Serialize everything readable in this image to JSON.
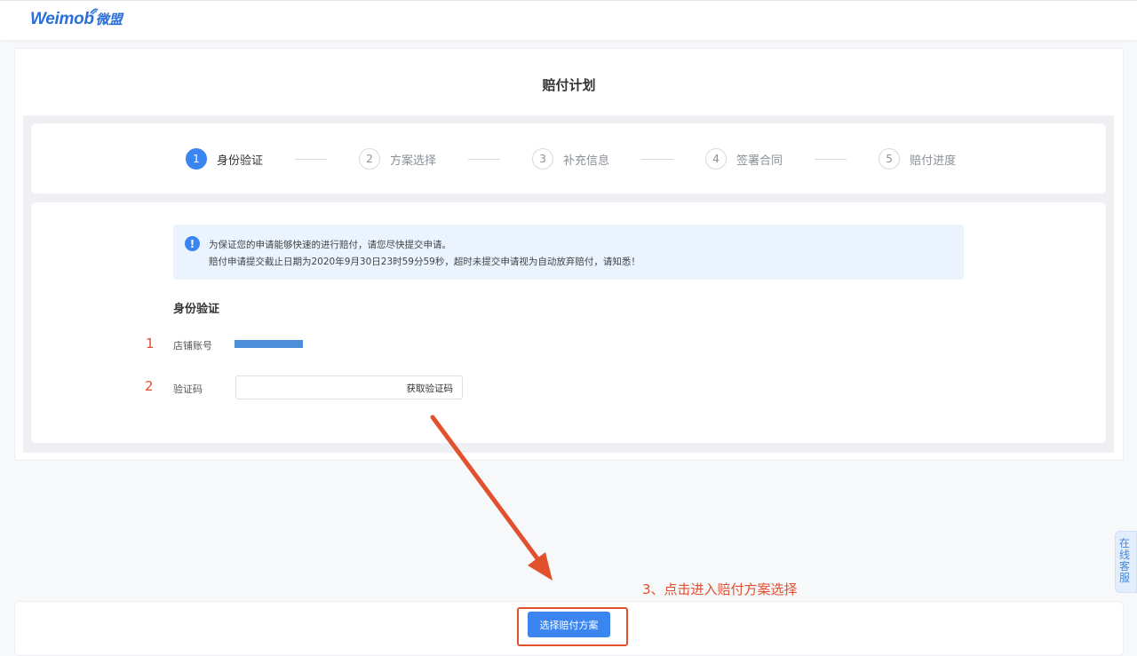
{
  "header": {
    "logo_en": "Weimob",
    "logo_cn": "微盟"
  },
  "page": {
    "title": "赔付计划"
  },
  "steps": [
    {
      "num": "1",
      "label": "身份验证",
      "active": true
    },
    {
      "num": "2",
      "label": "方案选择",
      "active": false
    },
    {
      "num": "3",
      "label": "补充信息",
      "active": false
    },
    {
      "num": "4",
      "label": "签署合同",
      "active": false
    },
    {
      "num": "5",
      "label": "赔付进度",
      "active": false
    }
  ],
  "notice": {
    "icon": "!",
    "line1": "为保证您的申请能够快速的进行赔付，请您尽快提交申请。",
    "line2": "赔付申请提交截止日期为2020年9月30日23时59分59秒，超时未提交申请视为自动放弃赔付，请知悉！"
  },
  "form": {
    "section_title": "身份验证",
    "store_account": {
      "num": "1",
      "label": "店铺账号"
    },
    "verify_code": {
      "num": "2",
      "label": "验证码",
      "value": "",
      "get_code_label": "获取验证码"
    }
  },
  "side_service": {
    "label": "在线客服"
  },
  "footer": {
    "button_label": "选择赔付方案"
  },
  "annotation": {
    "text": "3、点击进入赔付方案选择",
    "color": "#e04e2f"
  },
  "colors": {
    "primary": "#3a85f0",
    "annotation": "#e04e2f",
    "notice_bg": "#eaf3fe"
  }
}
